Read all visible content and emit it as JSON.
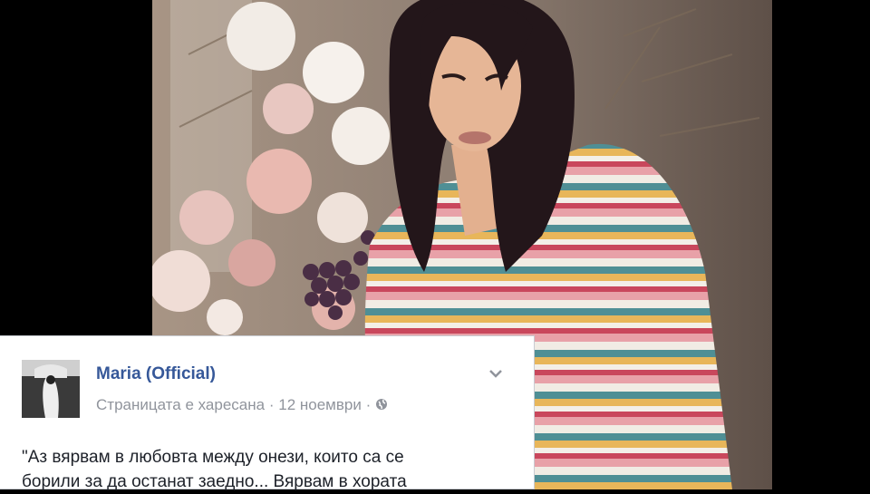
{
  "post": {
    "page_name": "Maria (Official)",
    "liked_status": "Страницата е харесана",
    "separator": "·",
    "date": "12 ноември",
    "audience_icon": "globe-icon",
    "menu_icon": "chevron-down-icon",
    "text_line1": "\"Аз вярвам в любовта между онези, които са се",
    "text_line2": "борили за да останат заедно... Вярвам в хората"
  },
  "colors": {
    "link": "#365899",
    "meta_text": "#90949c",
    "body_text": "#1d2129"
  }
}
